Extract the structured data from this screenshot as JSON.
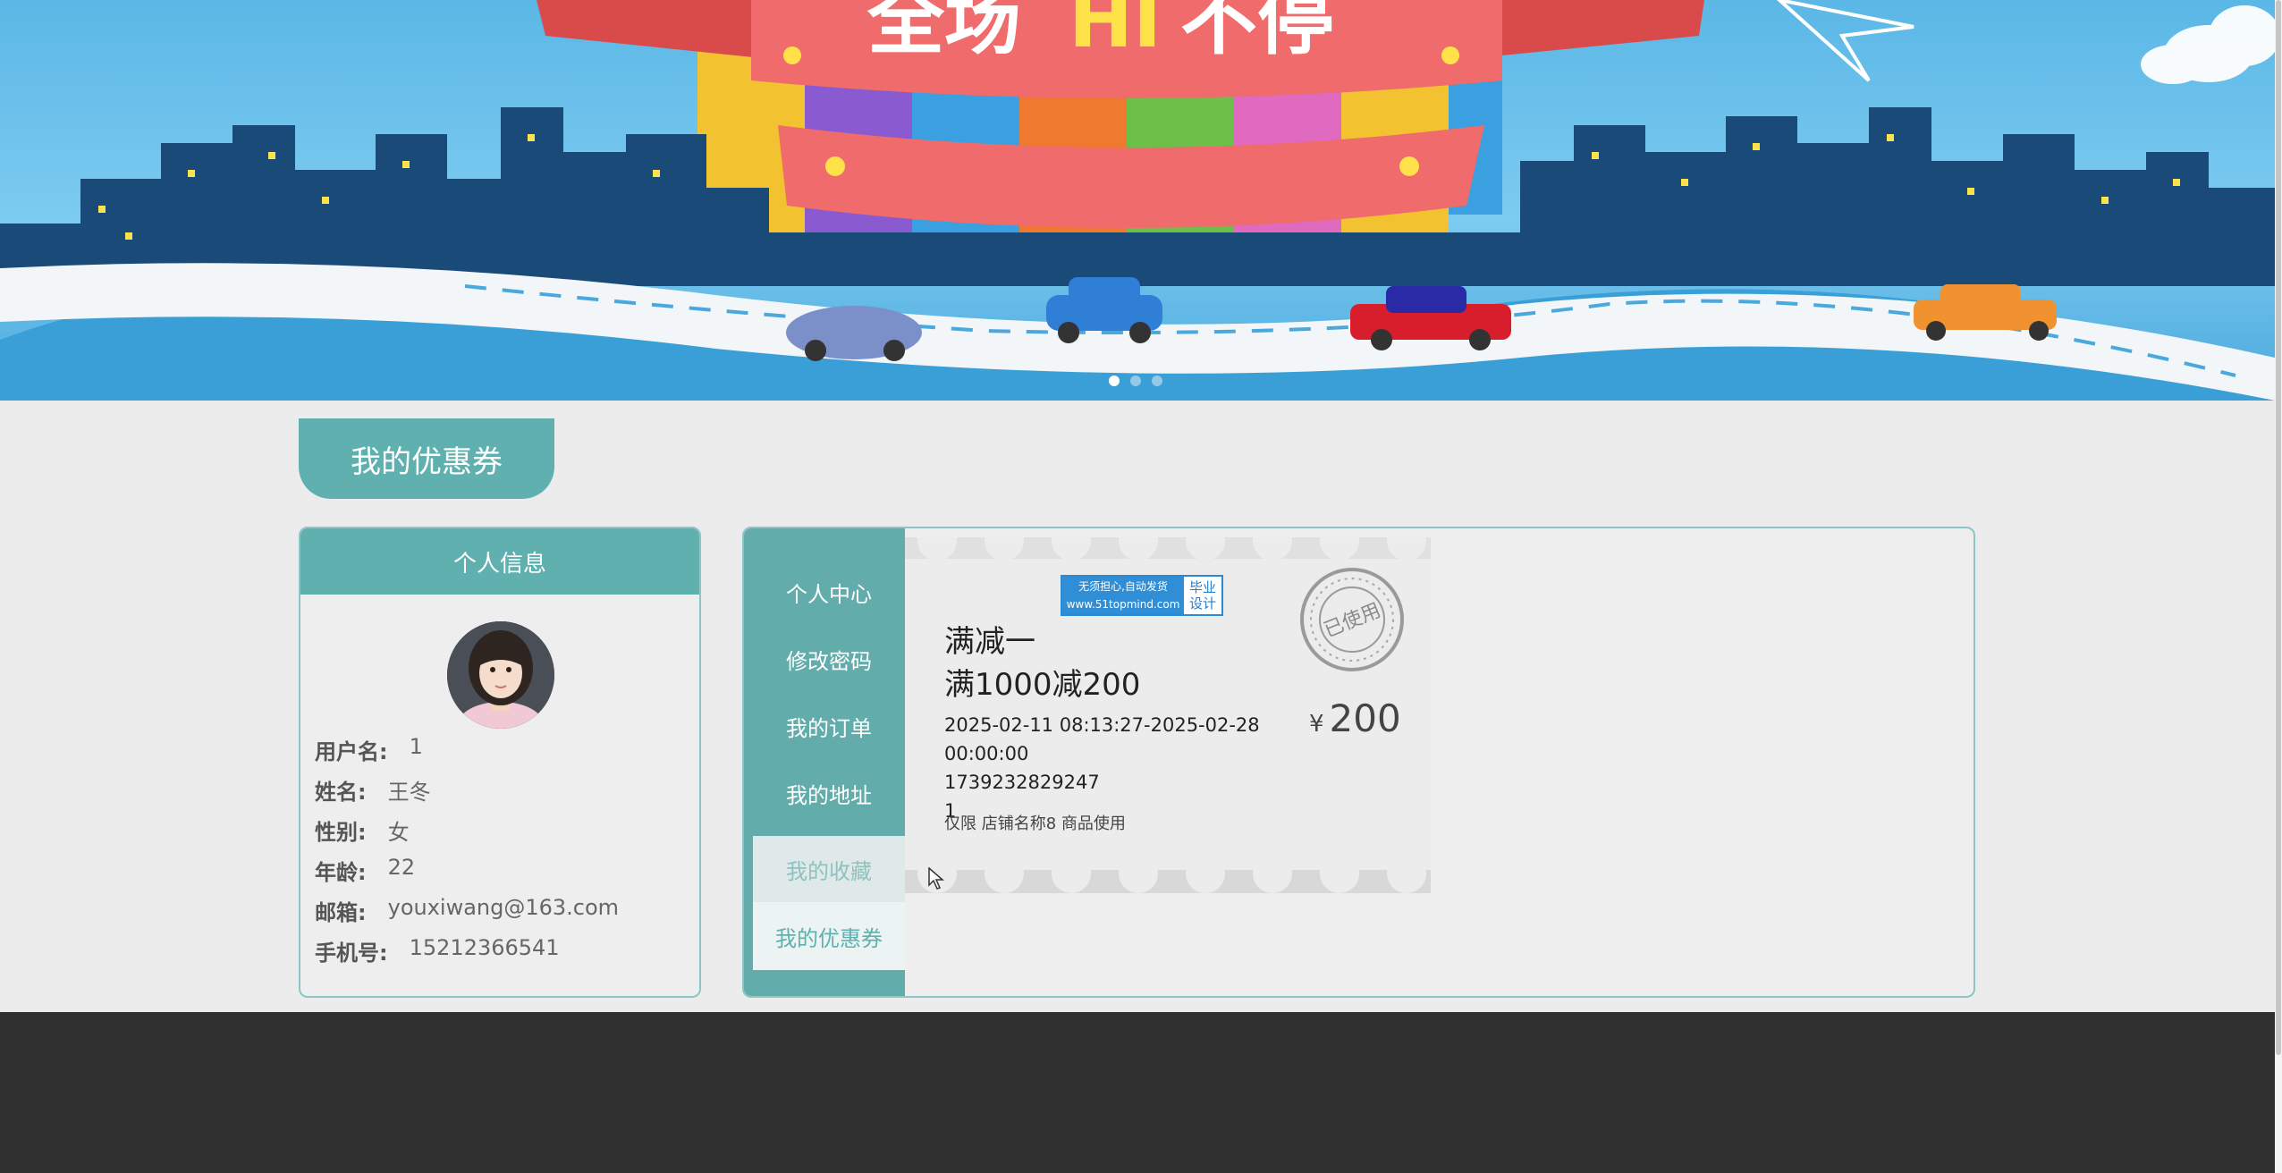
{
  "banner": {
    "slide_count": 3,
    "active_slide": 1,
    "colors": {
      "sky": "#5bb7e6",
      "city": "#1a4a78",
      "road": "#f3f6f8",
      "ribbon": "#f06b6b"
    }
  },
  "section_title": "我的优惠券",
  "profile": {
    "header": "个人信息",
    "fields": {
      "username": {
        "label": "用户名:",
        "value": "1"
      },
      "name": {
        "label": "姓名:",
        "value": "王冬"
      },
      "gender": {
        "label": "性别:",
        "value": "女"
      },
      "age": {
        "label": "年龄:",
        "value": "22"
      },
      "email": {
        "label": "邮箱:",
        "value": "youxiwang@163.com"
      },
      "phone": {
        "label": "手机号:",
        "value": "15212366541"
      }
    }
  },
  "menu": {
    "items": [
      {
        "label": "个人中心"
      },
      {
        "label": "修改密码"
      },
      {
        "label": "我的订单"
      },
      {
        "label": "我的地址"
      },
      {
        "label": "我的收藏"
      },
      {
        "label": "我的优惠券"
      }
    ],
    "active": "我的优惠券",
    "colors": {
      "sidebar": "#62adab",
      "accent": "#5fb0ae"
    }
  },
  "coupon": {
    "title": "满减一",
    "subtitle": "满1000减200",
    "validity_start": "2025-02-11 08:13:27-2025-02-28",
    "validity_end": "00:00:00",
    "code": "1739232829247",
    "quantity": "1",
    "scope": "仅限 店铺名称8 商品使用",
    "currency": "¥",
    "amount": "200",
    "stamp_text": "已使用"
  },
  "watermark": {
    "line1": "无须担心,自动发货",
    "line2": "www.51topmind.com",
    "right_line1": "毕业",
    "right_line2": "设计"
  }
}
